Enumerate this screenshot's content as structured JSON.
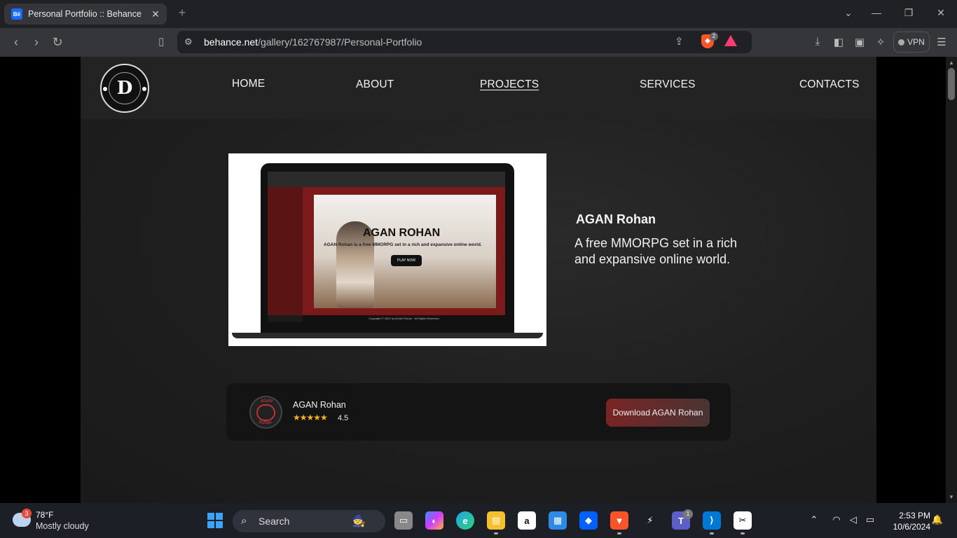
{
  "browser": {
    "tab_title": "Personal Portfolio :: Behance",
    "favicon_text": "Bē",
    "url_host": "behance.net",
    "url_path": "/gallery/162767987/Personal-Portfolio",
    "shield_count": "2",
    "vpn_label": "VPN"
  },
  "site": {
    "logo_letter": "D",
    "nav": [
      "HOME",
      "ABOUT",
      "PROJECTS",
      "SERVICES",
      "CONTACTS"
    ],
    "active_nav": "PROJECTS"
  },
  "project": {
    "title": "AGAN Rohan",
    "description": "A free MMORPG set in a rich and expansive online world.",
    "mockup": {
      "hero_title": "AGAN ROHAN",
      "hero_subtitle": "AGAN Rohan is a free MMORPG set in a rich and expansive online world.",
      "hero_button": "PLAY NOW",
      "footer": "Copyright © 2022 by AGAN Rohan · All Rights Reserved"
    }
  },
  "download_card": {
    "app_name": "AGAN Rohan",
    "icon_text_top": "AGAN",
    "icon_text_bottom": "Rohan",
    "stars": "★★★★★",
    "rating": "4.5",
    "button_label": "Download AGAN Rohan"
  },
  "taskbar": {
    "weather_badge": "3",
    "temperature": "78°F",
    "condition": "Mostly cloudy",
    "search_label": "Search",
    "teams_badge": "1",
    "time": "2:53 PM",
    "date": "10/6/2024",
    "apps": [
      "task-view",
      "copilot",
      "edge",
      "file-explorer",
      "amazon",
      "microsoft-store",
      "dropbox",
      "brave",
      "capcut-alt",
      "teams",
      "vscode",
      "capcut"
    ]
  },
  "colors": {
    "accent_brand": "#1769ff",
    "download_button": "#7a2424",
    "star": "#f5b324"
  }
}
